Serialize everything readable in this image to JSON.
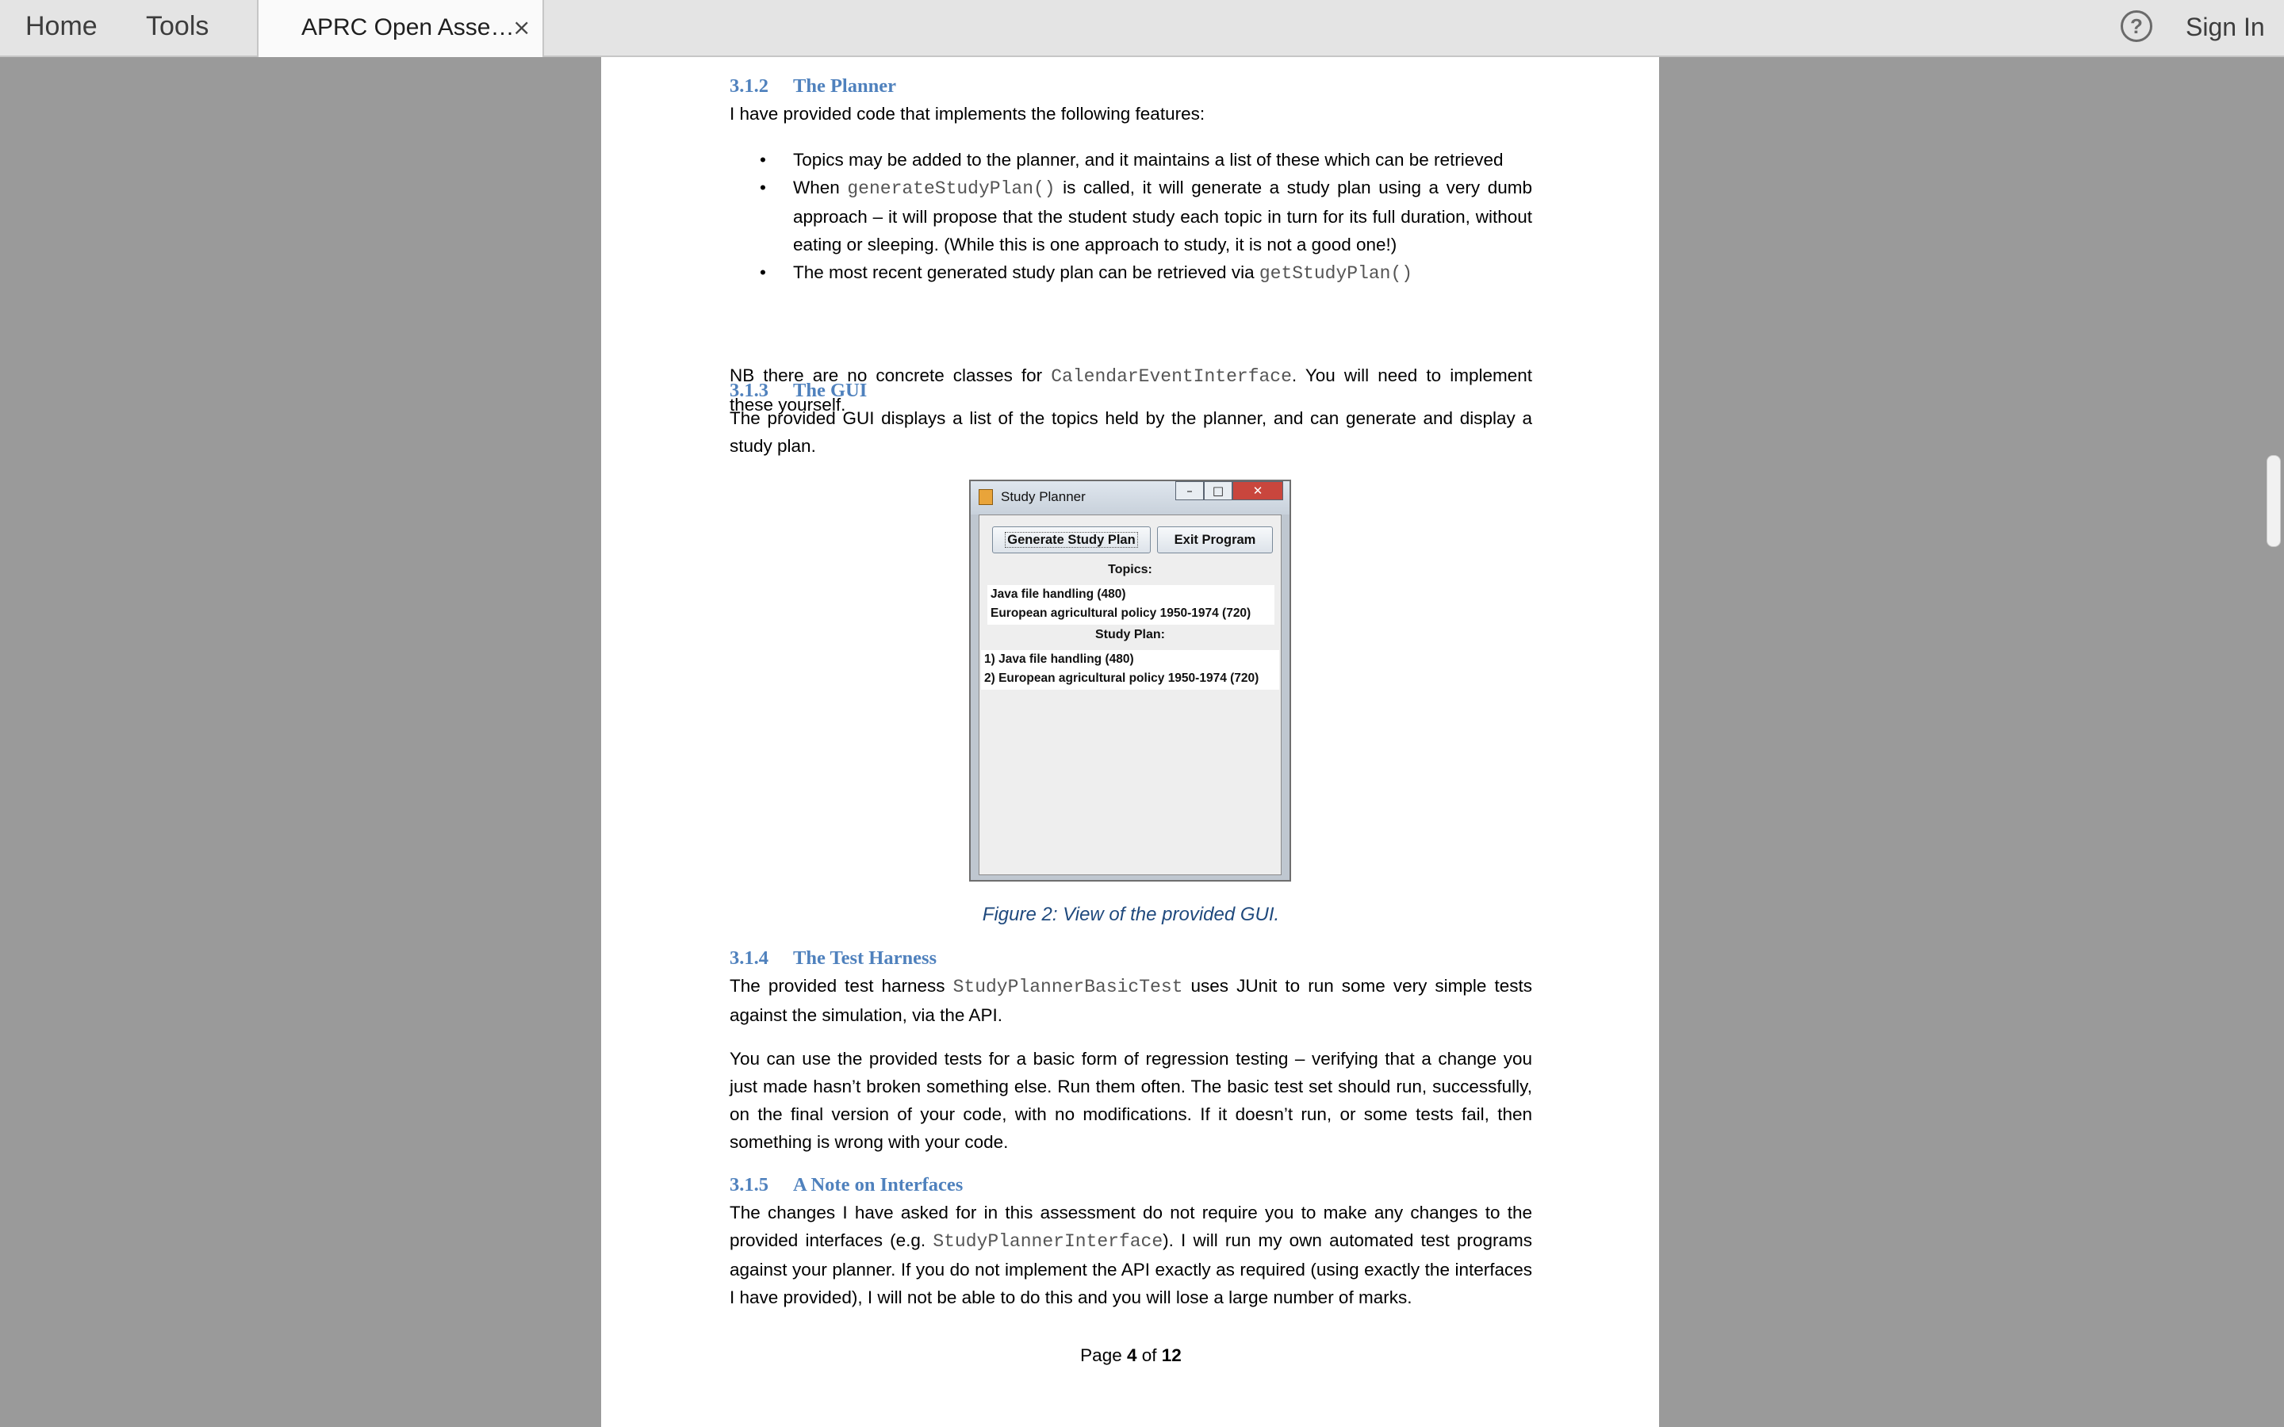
{
  "toolbar": {
    "home_label": "Home",
    "tools_label": "Tools",
    "tab_title": "APRC Open Asse…",
    "tab_close": "×",
    "help_icon": "?",
    "sign_in_label": "Sign In"
  },
  "doc": {
    "s312": {
      "num": "3.1.2",
      "title": "The Planner",
      "intro": "I have provided code that implements the following features:",
      "bullet1": "Topics may be added to the planner, and it maintains a list of these which can be retrieved",
      "bullet2_pre": "When ",
      "bullet2_code": "generateStudyPlan()",
      "bullet2_post": " is called, it will generate a study plan using a very dumb approach – it will propose that the student study each topic in turn for its full duration, without eating or sleeping. (While this is one approach to study, it is not a good one!)",
      "bullet3_pre": "The most recent generated study plan can be retrieved via ",
      "bullet3_code": "getStudyPlan()",
      "nb_pre": "NB there are no concrete classes for ",
      "nb_code": "CalendarEventInterface",
      "nb_post": ". You will need to implement these yourself."
    },
    "s313": {
      "num": "3.1.3",
      "title": "The GUI",
      "text": "The provided GUI displays a list of the topics held by the planner, and can generate and display a study plan."
    },
    "figure": {
      "window_title": "Study Planner",
      "btn_min": "–",
      "btn_max": "□",
      "btn_close": "✕",
      "generate_label": "Generate Study Plan",
      "exit_label": "Exit Program",
      "topics_label": "Topics:",
      "topics": [
        "Java file handling (480)",
        "European agricultural policy 1950-1974 (720)"
      ],
      "plan_label": "Study Plan:",
      "plan": [
        "1) Java file handling (480)",
        "2) European agricultural policy 1950-1974 (720)"
      ],
      "caption": "Figure 2: View of the provided GUI."
    },
    "s314": {
      "num": "3.1.4",
      "title": "The Test Harness",
      "p1_pre": "The provided test harness ",
      "p1_code": "StudyPlannerBasicTest",
      "p1_post": " uses JUnit to run some very simple tests against the simulation, via the API.",
      "p2": "You can use the provided tests for a basic form of regression testing – verifying that a change you just made hasn’t broken something else. Run them often. The basic test set should run, successfully, on the final version of your code, with no modifications. If it doesn’t run, or some tests fail, then something is wrong with your code."
    },
    "s315": {
      "num": "3.1.5",
      "title": "A Note on Interfaces",
      "p_pre": "The changes I have asked for in this assessment do not require you to make any changes to the provided interfaces (e.g. ",
      "p_code": "StudyPlannerInterface",
      "p_post": "). I will run my own automated test programs against your planner. If you do not implement the API exactly as required (using exactly the interfaces I have provided), I will not be able to do this and you will lose a large number of marks."
    },
    "footer": {
      "page_word": "Page ",
      "page_num": "4",
      "of_word": " of ",
      "page_total": "12"
    }
  },
  "colors": {
    "heading": "#4f81bd",
    "caption": "#1f497d",
    "background": "#9a9a9a"
  }
}
